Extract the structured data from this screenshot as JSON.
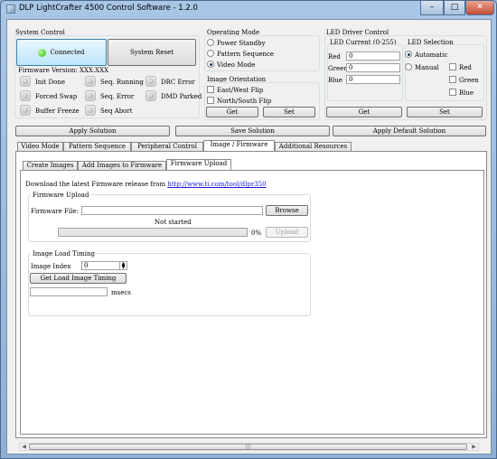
{
  "window": {
    "title": "DLP LightCrafter 4500 Control Software - 1.2.0",
    "minimize": "–",
    "maximize": "□",
    "close": "✕"
  },
  "system_control": {
    "title": "System Control",
    "connected_label": "Connected",
    "reset_label": "System Reset",
    "firmware_version": "Firmware Version: XXX.XXX",
    "status_leds": [
      {
        "label": "Init Done"
      },
      {
        "label": "Seq. Running"
      },
      {
        "label": "DRC Error"
      },
      {
        "label": "Forced Swap"
      },
      {
        "label": "Seq. Error"
      },
      {
        "label": "DMD Parked"
      },
      {
        "label": "Buffer Freeze"
      },
      {
        "label": "Seq Abort"
      }
    ]
  },
  "operating_mode": {
    "title": "Operating Mode",
    "options": [
      "Power Standby",
      "Pattern Sequence",
      "Video Mode"
    ],
    "selected": "Video Mode"
  },
  "image_orientation": {
    "title": "Image Orientation",
    "options": [
      "East/West Flip",
      "North/South Flip"
    ],
    "get_label": "Get",
    "set_label": "Set"
  },
  "led_driver": {
    "title": "LED Driver Control",
    "current_title": "LED Current (0-255)",
    "red_label": "Red",
    "green_label": "Green",
    "blue_label": "Blue",
    "red_value": "0",
    "green_value": "0",
    "blue_value": "0",
    "selection_title": "LED Selection",
    "automatic_label": "Automatic",
    "manual_label": "Manual",
    "sel_red": "Red",
    "sel_green": "Green",
    "sel_blue": "Blue",
    "get_label": "Get",
    "set_label": "Set"
  },
  "actions": {
    "apply_solution": "Apply Solution",
    "save_solution": "Save Solution",
    "apply_default": "Apply Default Solution"
  },
  "main_tabs": [
    "Video Mode",
    "Pattern Sequence",
    "Peripheral Control",
    "Image / Firmware",
    "Additional Resources"
  ],
  "sub_tabs": [
    "Create Images",
    "Add Images to Firmware",
    "Firmware Upload"
  ],
  "firmware_upload": {
    "download_text": "Download the latest Firmware release from",
    "download_link": "http://www.ti.com/tool/dlpr350",
    "group_title": "Firmware Upload",
    "file_label": "Firmware File:",
    "file_value": "",
    "browse_label": "Browse",
    "status": "Not started",
    "progress_percent": 0,
    "progress_text": "0%",
    "upload_label": "Upload"
  },
  "image_load_timing": {
    "title": "Image Load Timing",
    "index_label": "Image Index",
    "index_value": "0",
    "get_button": "Get Load Image Timing",
    "result_value": "",
    "unit": "msecs"
  },
  "scrollbar": {
    "left_arrow": "◀",
    "right_arrow": "▶",
    "grip": "|||"
  },
  "colors": {
    "title_bar": "#a9c6e6",
    "client_bg": "#f0f0f0",
    "connected_led": "#2fb812",
    "link": "#1a1ad6",
    "progress": "#23b123"
  }
}
